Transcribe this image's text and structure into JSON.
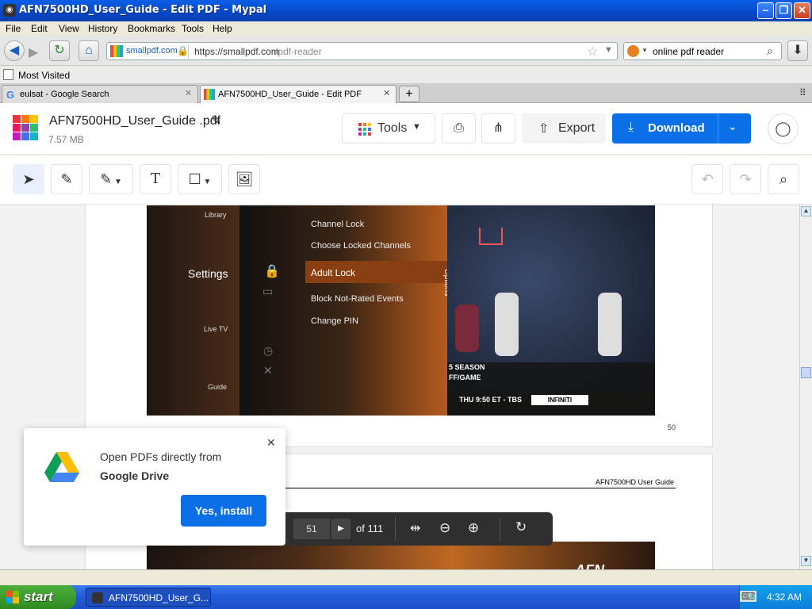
{
  "window": {
    "title": "AFN7500HD_User_Guide - Edit PDF - Mypal"
  },
  "menu": [
    "File",
    "Edit",
    "View",
    "History",
    "Bookmarks",
    "Tools",
    "Help"
  ],
  "nav": {
    "site_badge": "smallpdf.com",
    "url_prefix": "https://smallpdf.com",
    "url_path": "/pdf-reader",
    "search_value": "online pdf reader"
  },
  "bookmarks": {
    "most_visited": "Most Visited"
  },
  "tabs": [
    {
      "label": "eulsat - Google Search"
    },
    {
      "label": "AFN7500HD_User_Guide - Edit PDF"
    }
  ],
  "app": {
    "file_name": "AFN7500HD_User_Guide .pdf",
    "file_size": "7.57 MB",
    "tools_label": "Tools",
    "export_label": "Export",
    "download_label": "Download",
    "accent": "#0b6fe8"
  },
  "page1": {
    "menu_left": [
      "Library",
      "Settings",
      "Live TV",
      "Guide"
    ],
    "menu_mid": [
      "Channel Lock",
      "Choose Locked Channels",
      "Adult Lock",
      "Block Not-Rated Events",
      "Change PIN"
    ],
    "options": "Options",
    "ticker": "THU 9:50 ET - TBS",
    "brand": "INFINITI",
    "season": "5 SEASON",
    "game": "FF/GAME",
    "page_number": "50"
  },
  "page2": {
    "header": "AFN7500HD User Guide",
    "logo_text": "AFN"
  },
  "popup": {
    "line1": "Open PDFs directly from",
    "line2": "Google Drive",
    "button": "Yes, install"
  },
  "pager": {
    "current": "51",
    "total": "of 111"
  },
  "taskbar": {
    "start": "start",
    "item": "AFN7500HD_User_G...",
    "clock": "4:32 AM"
  }
}
